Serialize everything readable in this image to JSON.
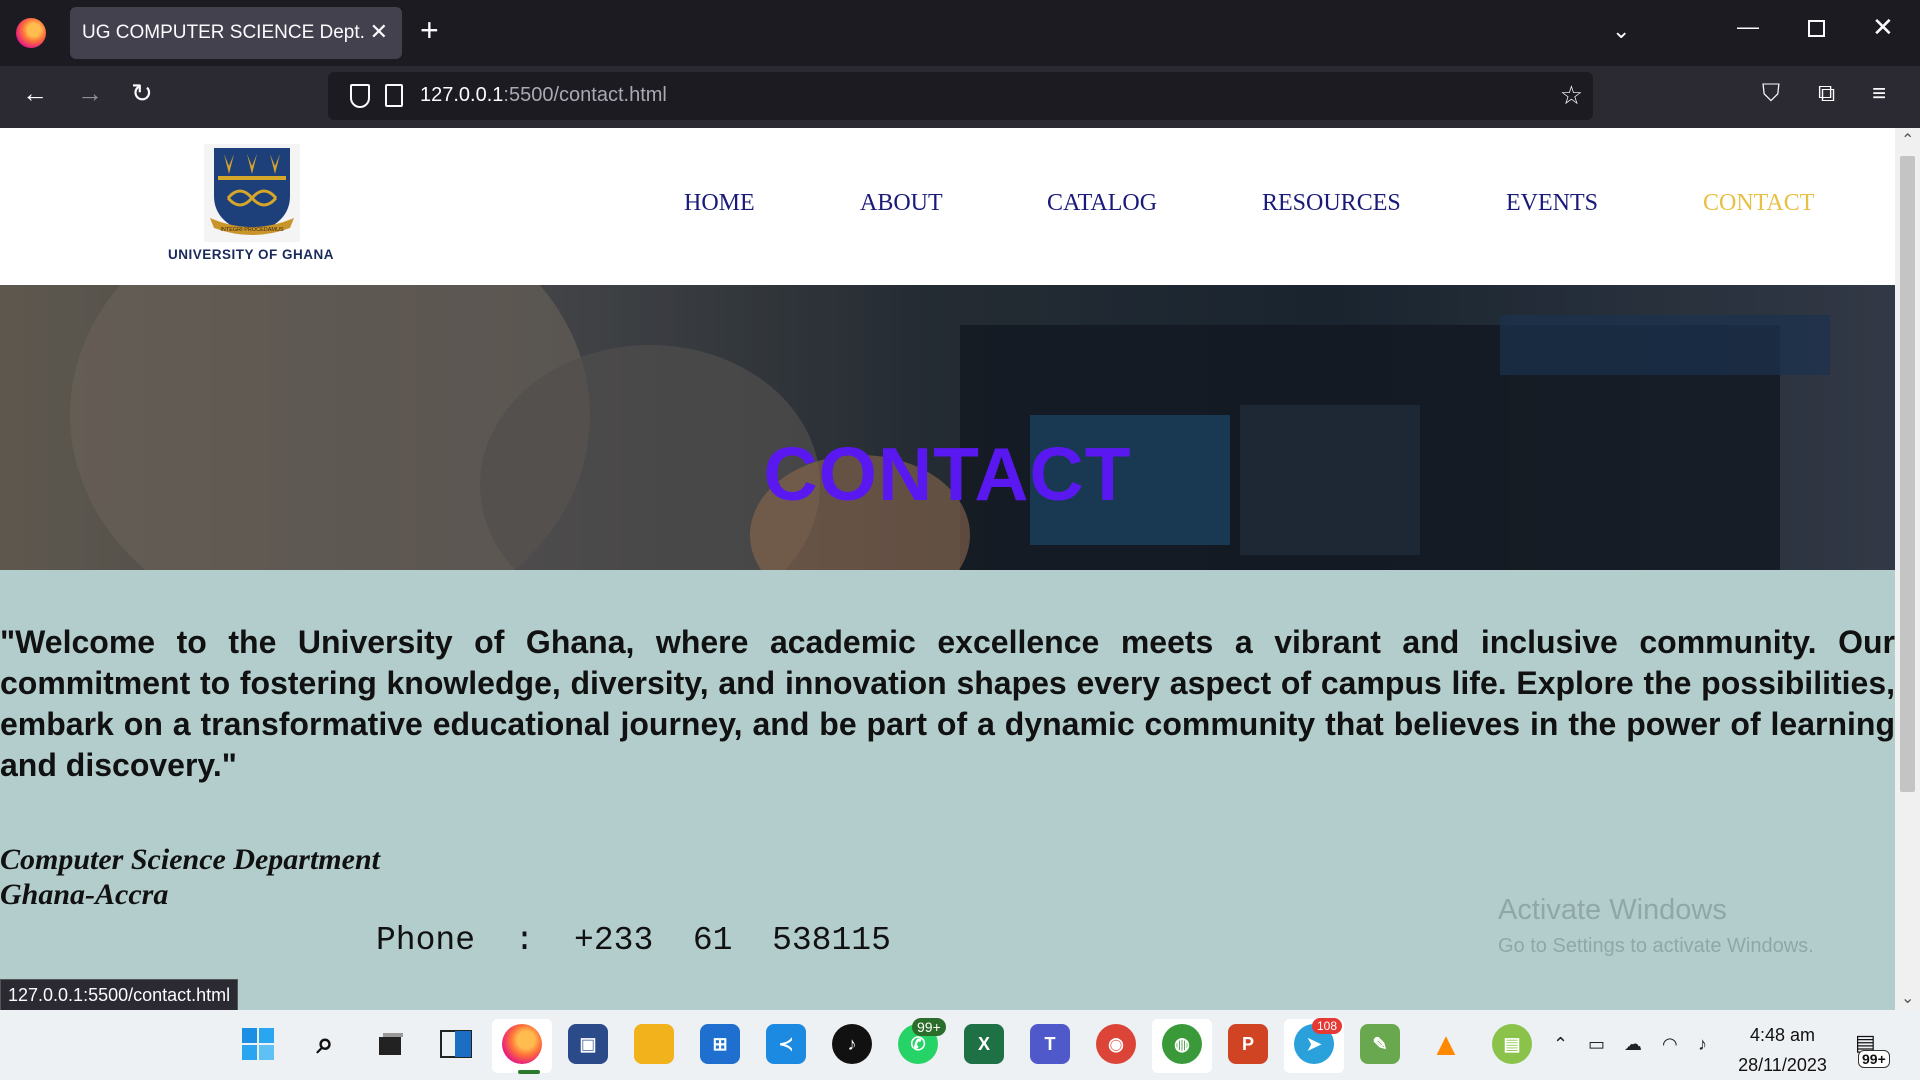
{
  "browser": {
    "tab_title": "UG COMPUTER SCIENCE Dept.",
    "url_host": "127.0.0.1",
    "url_rest": ":5500/contact.html",
    "status_url": "127.0.0.1:5500/contact.html"
  },
  "site": {
    "logo_text": "UNIVERSITY OF GHANA",
    "logo_motto": "INTEGRI PROCEDAMUS",
    "nav": [
      {
        "label": "HOME"
      },
      {
        "label": "ABOUT"
      },
      {
        "label": "CATALOG"
      },
      {
        "label": "RESOURCES"
      },
      {
        "label": "EVENTS"
      },
      {
        "label": "CONTACT",
        "active": true
      }
    ],
    "hero_title": "CONTACT",
    "quote": "\"Welcome to the University of Ghana, where academic excellence meets a vibrant and inclusive community. Our commitment to fostering knowledge, diversity, and innovation shapes every aspect of campus life. Explore the possibilities, embark on a transformative educational journey, and be part of a dynamic community that believes in the power of learning and discovery.\"",
    "address_line1": "Computer Science Department",
    "address_line2": "Ghana-Accra",
    "phone": "Phone  :  +233  61  538115"
  },
  "watermark": {
    "line1": "Activate Windows",
    "line2": "Go to Settings to activate Windows."
  },
  "taskbar": {
    "whatsapp_badge": "99+",
    "telegram_badge": "108",
    "time": "4:48 am",
    "date": "28/11/2023",
    "notif_badge": "99+"
  },
  "colors": {
    "accent_active_nav": "#e8c043",
    "hero_title": "#5a18f0",
    "content_bg": "#b3cdcd"
  }
}
